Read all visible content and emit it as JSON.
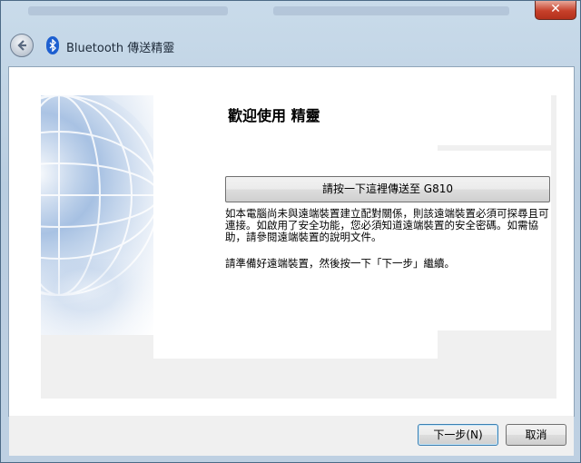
{
  "window": {
    "title": "Bluetooth 傳送精靈",
    "close_glyph": "✕"
  },
  "main": {
    "headline": "歡迎使用  精靈",
    "send_button_label": "請按一下這裡傳送至 G810",
    "description": "如本電腦尚未與遠端裝置建立配對關係，則該遠端裝置必須可探尋且可連接。如啟用了安全功能，您必須知道遠端裝置的安全密碼。如需協助，請參閱遠端裝置的說明文件。",
    "ready_text": "請準備好遠端裝置，然後按一下「下一步」繼續。"
  },
  "footer": {
    "next_label": "下一步(N)",
    "cancel_label": "取消"
  },
  "icons": {
    "back": "back-arrow-icon",
    "bluetooth": "bluetooth-icon",
    "globe": "globe-graphic"
  },
  "colors": {
    "close_button": "#c6402a",
    "bluetooth_blue": "#1d5fd0",
    "panel_gray": "#f0f0f0"
  }
}
